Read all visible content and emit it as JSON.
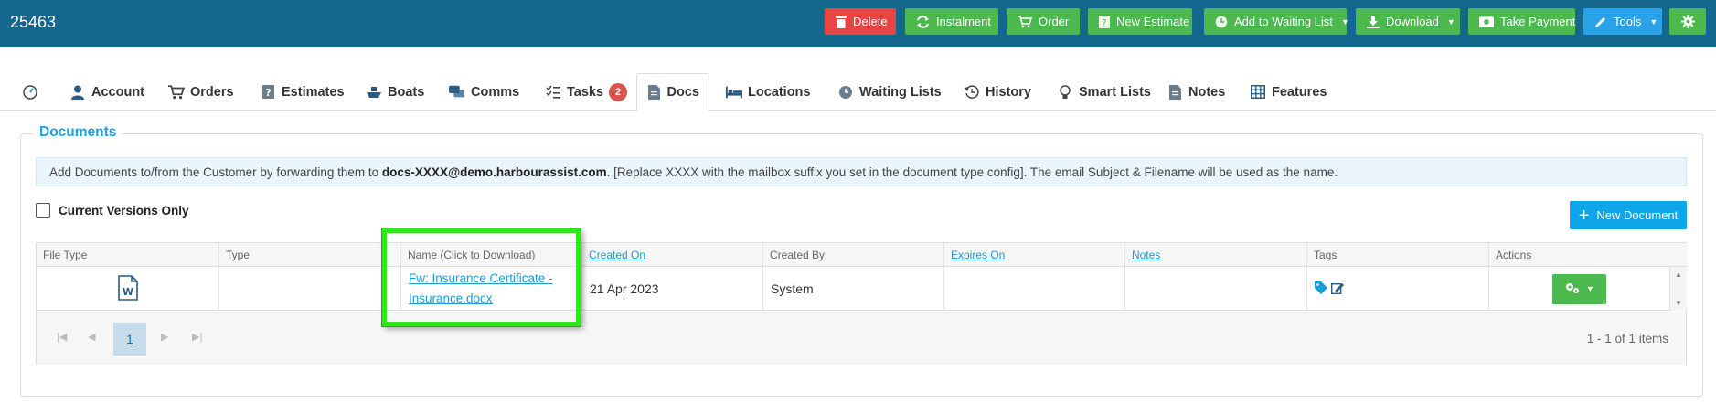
{
  "header": {
    "record_id": "25463",
    "buttons": {
      "delete": "Delete",
      "instalment": "Instalment",
      "order": "Order",
      "new_estimate": "New Estimate",
      "add_waiting": "Add to Waiting List",
      "download": "Download",
      "take_payment": "Take Payment",
      "tools": "Tools"
    }
  },
  "tabs": {
    "account": "Account",
    "orders": "Orders",
    "estimates": "Estimates",
    "boats": "Boats",
    "comms": "Comms",
    "tasks": "Tasks",
    "tasks_count": "2",
    "docs": "Docs",
    "locations": "Locations",
    "waiting_lists": "Waiting Lists",
    "history": "History",
    "smart_lists": "Smart Lists",
    "notes": "Notes",
    "features": "Features"
  },
  "documents": {
    "legend": "Documents",
    "info_prefix": "Add Documents to/from the Customer by forwarding them to ",
    "info_email": "docs-XXXX@demo.harbourassist.com",
    "info_suffix": ". [Replace XXXX with the mailbox suffix you set in the document type config]. The email Subject & Filename will be used as the name.",
    "current_versions_label": "Current Versions Only",
    "new_document": "New Document"
  },
  "grid": {
    "columns": {
      "file_type": "File Type",
      "type": "Type",
      "name": "Name (Click to Download)",
      "created_on": "Created On",
      "created_by": "Created By",
      "expires_on": "Expires On",
      "notes": "Notes",
      "tags": "Tags",
      "actions": "Actions"
    },
    "rows": [
      {
        "file_icon": "word-doc-icon",
        "type": "",
        "name_line1": "Fw: Insurance Certificate -",
        "name_line2": "Insurance.docx",
        "created_on": "21 Apr 2023",
        "created_by": "System",
        "expires_on": "",
        "notes": ""
      }
    ],
    "pager": {
      "page": "1",
      "summary": "1 - 1 of 1 items"
    }
  },
  "colors": {
    "header_bg": "#14688d",
    "danger": "#e84545",
    "success": "#4cb94e",
    "primary": "#2aa2e8",
    "accent_text": "#1da1e3",
    "highlight": "#2ee81c"
  }
}
